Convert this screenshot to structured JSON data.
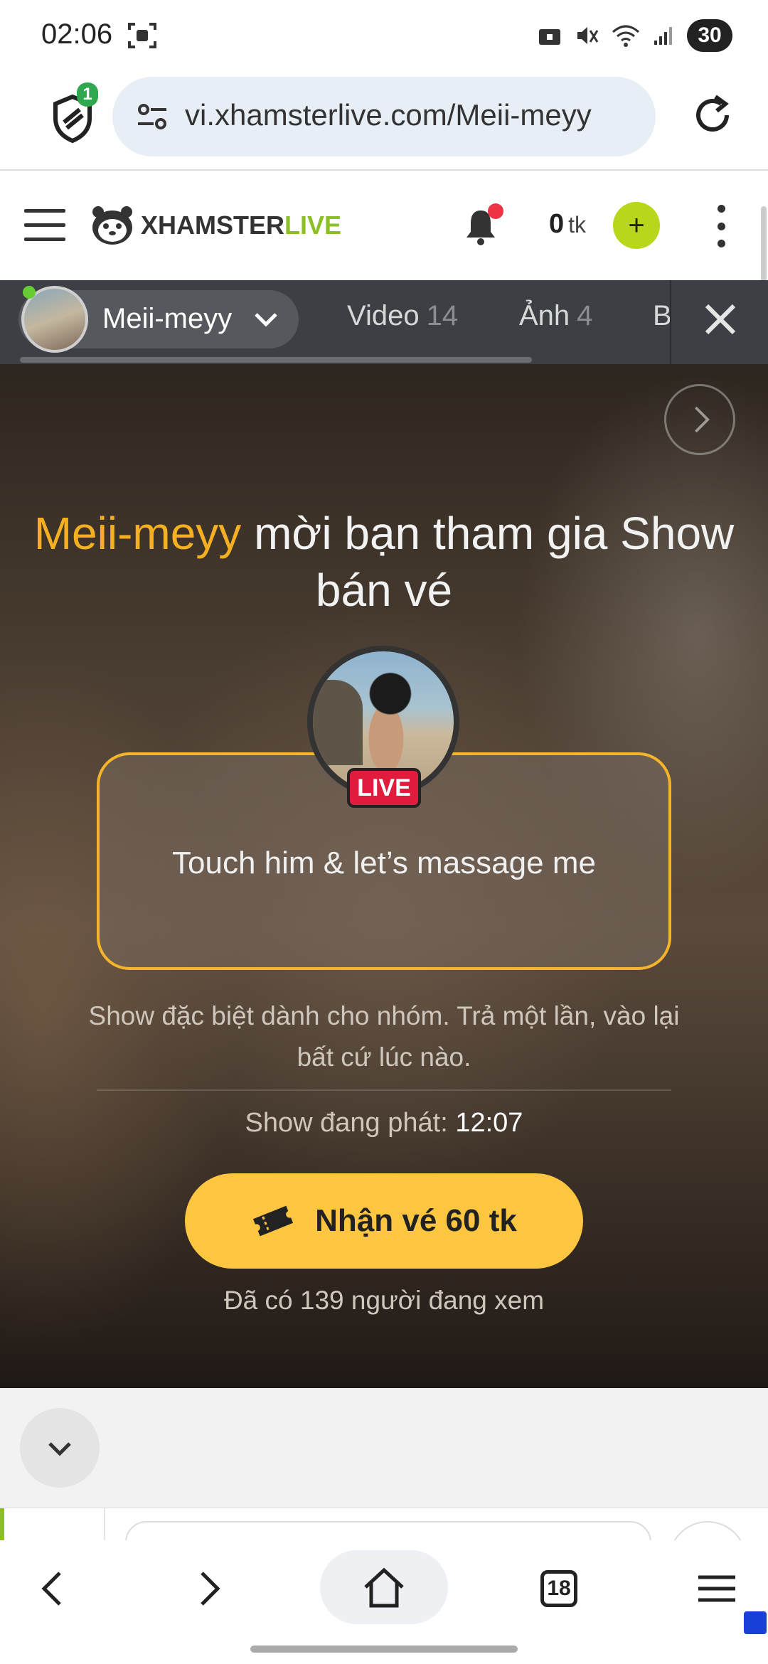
{
  "status_bar": {
    "time": "02:06",
    "battery": "30"
  },
  "browser": {
    "url": "vi.xhamsterlive.com/Meii-meyy",
    "shield_badge": "1"
  },
  "header": {
    "logo_part1": "XHAMSTER",
    "logo_part2": "LIVE",
    "balance_value": "0",
    "balance_unit": "tk",
    "add_label": "+"
  },
  "tabs": {
    "model_name": "Meii-meyy",
    "items": [
      {
        "label": "Video",
        "count": "14"
      },
      {
        "label": "Ảnh",
        "count": "4"
      },
      {
        "label": "B",
        "count": ""
      }
    ]
  },
  "hero": {
    "headline_name": "Meii-meyy",
    "headline_rest": " mời bạn tham gia Show bán vé",
    "card_text": "Touch him & let’s massage me",
    "live_badge": "LIVE",
    "description": "Show đặc biệt dành cho nhóm. Trả một lần, vào lại bất cứ lúc nào.",
    "airing_label": "Show đang phát:",
    "airing_time": "12:07",
    "ticket_button": "Nhận vé 60 tk",
    "watching": "Đã có 139 người đang xem"
  },
  "bottom_nav": {
    "tabs_count": "18"
  },
  "colors": {
    "accent_yellow": "#fcc640",
    "name_orange": "#f5b021",
    "live_red": "#e01b3c",
    "brand_green": "#8cbf26"
  }
}
